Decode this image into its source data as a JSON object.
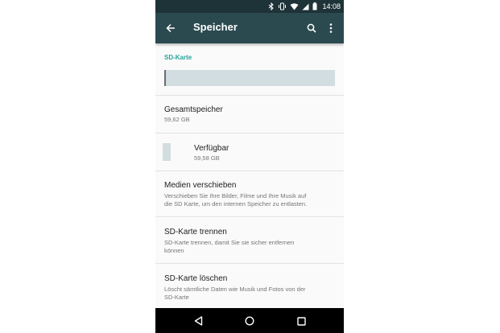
{
  "status_bar": {
    "time": "14:08",
    "icons": [
      "bluetooth-icon",
      "vibrate-icon",
      "wifi-icon",
      "cell-signal-icon",
      "battery-icon"
    ]
  },
  "app_bar": {
    "title": "Speicher",
    "icons": [
      "back-arrow-icon",
      "search-icon",
      "more-vert-icon"
    ]
  },
  "sd_card": {
    "header": "SD-Karte",
    "used_fraction": 0.01
  },
  "total": {
    "title": "Gesamtspeicher",
    "value": "59,62 GB"
  },
  "available": {
    "title": "Verfügbar",
    "value": "59,58 GB"
  },
  "items": [
    {
      "title": "Medien verschieben",
      "subtitle_line1": "Verschieben Sie Ihre Bilder, Filme und Ihre Musik auf",
      "subtitle_line2": "die SD Karte, um den internen Speicher zu entlasten."
    },
    {
      "title": "SD-Karte trennen",
      "subtitle_line1": "SD-Karte trennen, damit Sie sie sicher entfernen",
      "subtitle_line2": "können"
    },
    {
      "title": "SD-Karte löschen",
      "subtitle_line1": "Löscht sämtliche Daten wie Musik und Fotos von der",
      "subtitle_line2": "SD-Karte"
    }
  ],
  "nav_bar": {
    "icons": [
      "back-triangle-icon",
      "home-circle-icon",
      "recents-square-icon"
    ]
  },
  "colors": {
    "status_bar": "#1e3338",
    "app_bar": "#2b4a50",
    "accent": "#26a69a",
    "bar_free": "#d1dde0",
    "bar_used": "#6d6d6d"
  }
}
